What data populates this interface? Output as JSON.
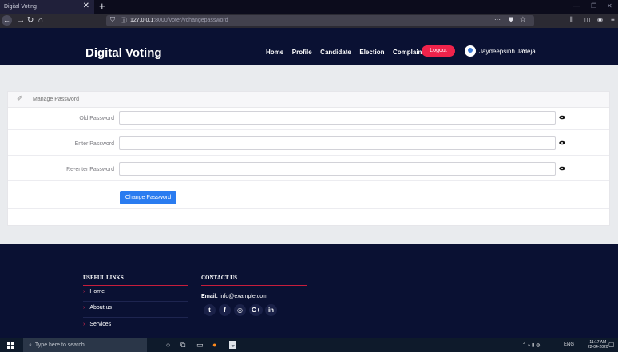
{
  "browser": {
    "tab_title": "Digital Voting",
    "tab_close": "✕",
    "new_tab": "+",
    "url_host": "127.0.0.1",
    "url_path": ":8000/voter/vchangepassword",
    "window_minimize": "—",
    "window_maximize": "❐",
    "window_close": "✕"
  },
  "navbar": {
    "brand": "Digital Voting",
    "links": [
      "Home",
      "Profile",
      "Candidate",
      "Election",
      "Complain"
    ],
    "logout_label": "Logout",
    "username": "Jaydeepsinh Jadeja"
  },
  "form": {
    "title": "Manage Password",
    "fields": [
      {
        "label": "Old Password",
        "value": ""
      },
      {
        "label": "Enter Password",
        "value": ""
      },
      {
        "label": "Re-enter Password",
        "value": ""
      }
    ],
    "submit_label": "Change Password"
  },
  "footer": {
    "useful_links_title": "USEFUL LINKS",
    "useful_links": [
      "Home",
      "About us",
      "Services"
    ],
    "contact_title": "CONTACT US",
    "email_label": "Email:",
    "email_value": "info@example.com",
    "social": [
      "twitter-icon",
      "facebook-icon",
      "instagram-icon",
      "google-plus-icon",
      "linkedin-icon"
    ]
  },
  "taskbar": {
    "search_placeholder": "Type here to search",
    "language": "ENG",
    "time": "11:17 AM",
    "date": "22-04-2020"
  },
  "colors": {
    "navbar_bg": "#0a1133",
    "logout_bg": "#f0234b",
    "primary_button": "#2a7cf0",
    "footer_accent": "#c71d3c"
  }
}
